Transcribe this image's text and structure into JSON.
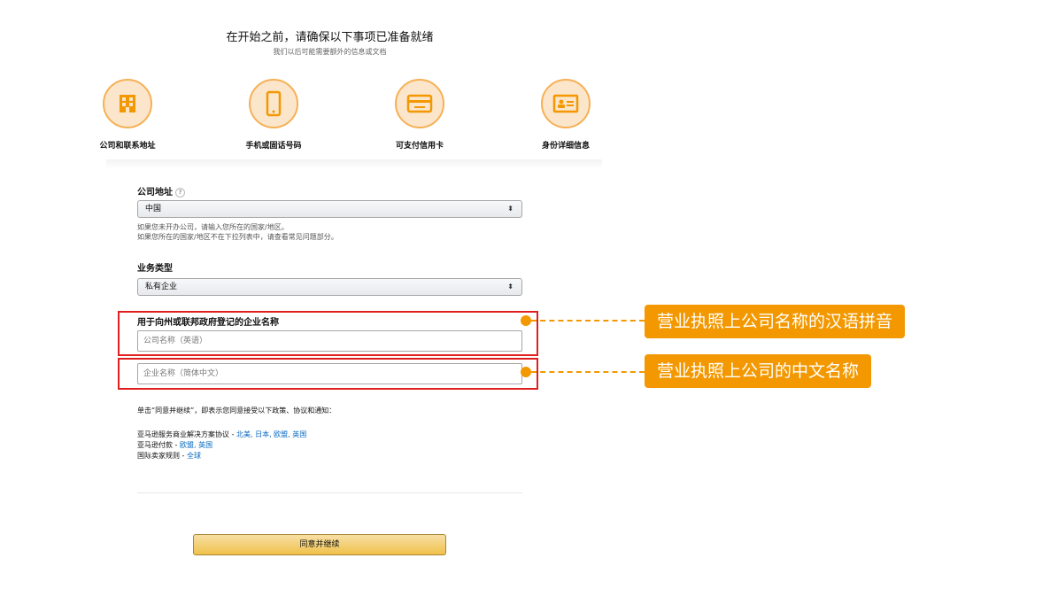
{
  "header": {
    "title": "在开始之前，请确保以下事项已准备就绪",
    "subtitle": "我们以后可能需要额外的信息或文档"
  },
  "requirements": [
    {
      "label": "公司和联系地址",
      "icon": "building-icon"
    },
    {
      "label": "手机或固话号码",
      "icon": "phone-icon"
    },
    {
      "label": "可支付信用卡",
      "icon": "credit-card-icon"
    },
    {
      "label": "身份详细信息",
      "icon": "id-card-icon"
    }
  ],
  "form": {
    "company_address_label": "公司地址",
    "help_glyph": "?",
    "country_value": "中国",
    "country_hint_1": "如果您未开办公司，请输入您所在的国家/地区。",
    "country_hint_2": "如果您所在的国家/地区不在下拉列表中，请查看常见问题部分。",
    "business_type_label": "业务类型",
    "business_type_value": "私有企业",
    "legal_name_label": "用于向州或联邦政府登记的企业名称",
    "name_en_placeholder": "公司名称（英语）",
    "name_cn_placeholder": "企业名称（简体中文）",
    "select_arrows": "⬍"
  },
  "callouts": {
    "pinyin": "营业执照上公司名称的汉语拼音",
    "chinese": "营业执照上公司的中文名称"
  },
  "agreement": {
    "intro": "单击“同意并继续”，即表示您同意接受以下政策、协议和通知：",
    "lines": [
      {
        "text": "亚马逊服务商业解决方案协议 - ",
        "links": "北美, 日本, 欧盟, 英国"
      },
      {
        "text": "亚马逊付款 - ",
        "links": "欧盟, 英国"
      },
      {
        "text": "国际卖家规则 - ",
        "links": "全球"
      }
    ]
  },
  "submit_label": "同意并继续",
  "colors": {
    "accent_orange": "#f39800",
    "highlight_red": "#e02020",
    "link_blue": "#0066c0",
    "button_yellow": "#f0c14b"
  }
}
